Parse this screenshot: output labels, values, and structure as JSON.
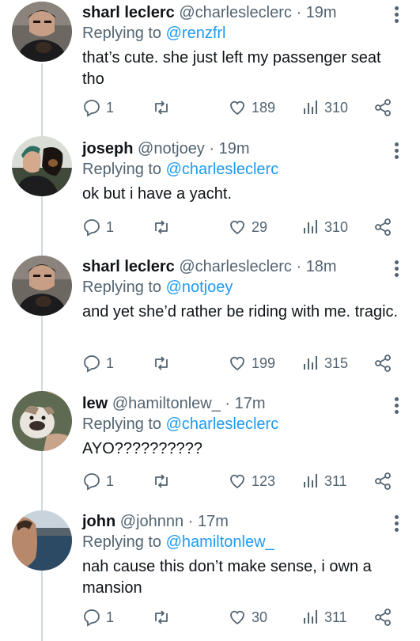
{
  "replying_prefix": "Replying to",
  "tweets": [
    {
      "name": "sharl leclerc",
      "handle": "@charlesleclerc",
      "dot": "·",
      "time": "19m",
      "reply_to": "@renzfrl",
      "text": "that’s cute. she just left my passenger seat tho",
      "replies": "1",
      "likes": "189",
      "views": "310",
      "avatar_icon": "man-holding-puppy-avatar"
    },
    {
      "name": "joseph",
      "handle": "@notjoey",
      "dot": "·",
      "time": "19m",
      "reply_to": "@charlesleclerc",
      "text": "ok but i have a yacht.",
      "replies": "1",
      "likes": "29",
      "views": "310",
      "avatar_icon": "man-with-dog-avatar"
    },
    {
      "name": "sharl leclerc",
      "handle": "@charlesleclerc",
      "dot": "·",
      "time": "18m",
      "reply_to": "@notjoey",
      "text": "and yet she’d rather be riding with me. tragic.",
      "replies": "1",
      "likes": "199",
      "views": "315",
      "avatar_icon": "man-holding-puppy-avatar"
    },
    {
      "name": "lew",
      "handle": "@hamiltonlew_",
      "dot": "·",
      "time": "17m",
      "reply_to": "@charlesleclerc",
      "text": "AYO??????????",
      "replies": "1",
      "likes": "123",
      "views": "311",
      "avatar_icon": "bulldog-avatar"
    },
    {
      "name": "john",
      "handle": "@johnnn",
      "dot": "·",
      "time": "17m",
      "reply_to": "@hamiltonlew_",
      "text": "nah cause this don’t make sense, i own a mansion",
      "replies": "1",
      "likes": "30",
      "views": "311",
      "avatar_icon": "man-at-sea-avatar"
    }
  ],
  "colors": {
    "link": "#1d9bf0",
    "secondary": "#536471",
    "primary": "#0f1419",
    "thread_line": "#cfd9de"
  }
}
